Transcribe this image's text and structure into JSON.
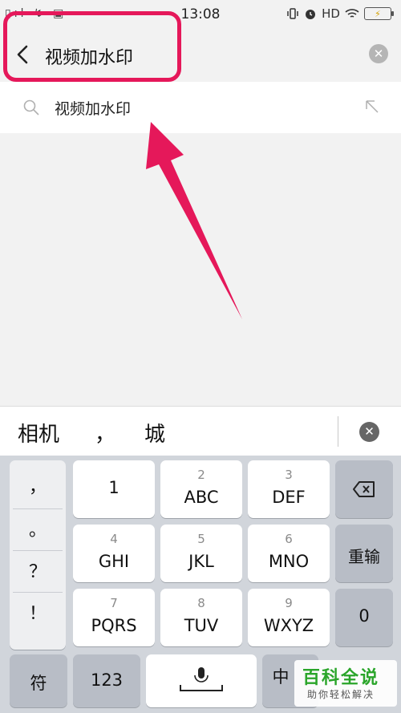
{
  "status_bar": {
    "time": "13:08",
    "left_icons": "▯ıl ↯ ▣",
    "network": "HD",
    "battery_icon": "battery-charging-icon"
  },
  "search_header": {
    "query": "视频加水印",
    "back_icon": "chevron-left-icon",
    "clear_icon": "clear-circle-icon"
  },
  "suggestion": {
    "text": "视频加水印",
    "search_icon": "search-icon",
    "fill_icon": "arrow-up-left-icon"
  },
  "candidates": [
    "相机",
    "，",
    "城"
  ],
  "keyboard": {
    "punctuation": [
      "，",
      "。",
      "？",
      "！"
    ],
    "keys": [
      {
        "num": "",
        "letters": "1"
      },
      {
        "num": "2",
        "letters": "ABC"
      },
      {
        "num": "3",
        "letters": "DEF"
      },
      {
        "num": "4",
        "letters": "GHI"
      },
      {
        "num": "5",
        "letters": "JKL"
      },
      {
        "num": "6",
        "letters": "MNO"
      },
      {
        "num": "7",
        "letters": "PQRS"
      },
      {
        "num": "8",
        "letters": "TUV"
      },
      {
        "num": "9",
        "letters": "WXYZ"
      }
    ],
    "delete_icon": "backspace-icon",
    "reenter_label": "重输",
    "zero_label": "0",
    "symbol_label": "符",
    "numeric_label": "123",
    "space_icon": "microphone-icon",
    "lang_label": "中"
  },
  "watermark": {
    "title": "百科全说",
    "subtitle": "助你轻松解决"
  },
  "colors": {
    "annotation": "#e5185a",
    "watermark_green": "#2aa52a"
  }
}
